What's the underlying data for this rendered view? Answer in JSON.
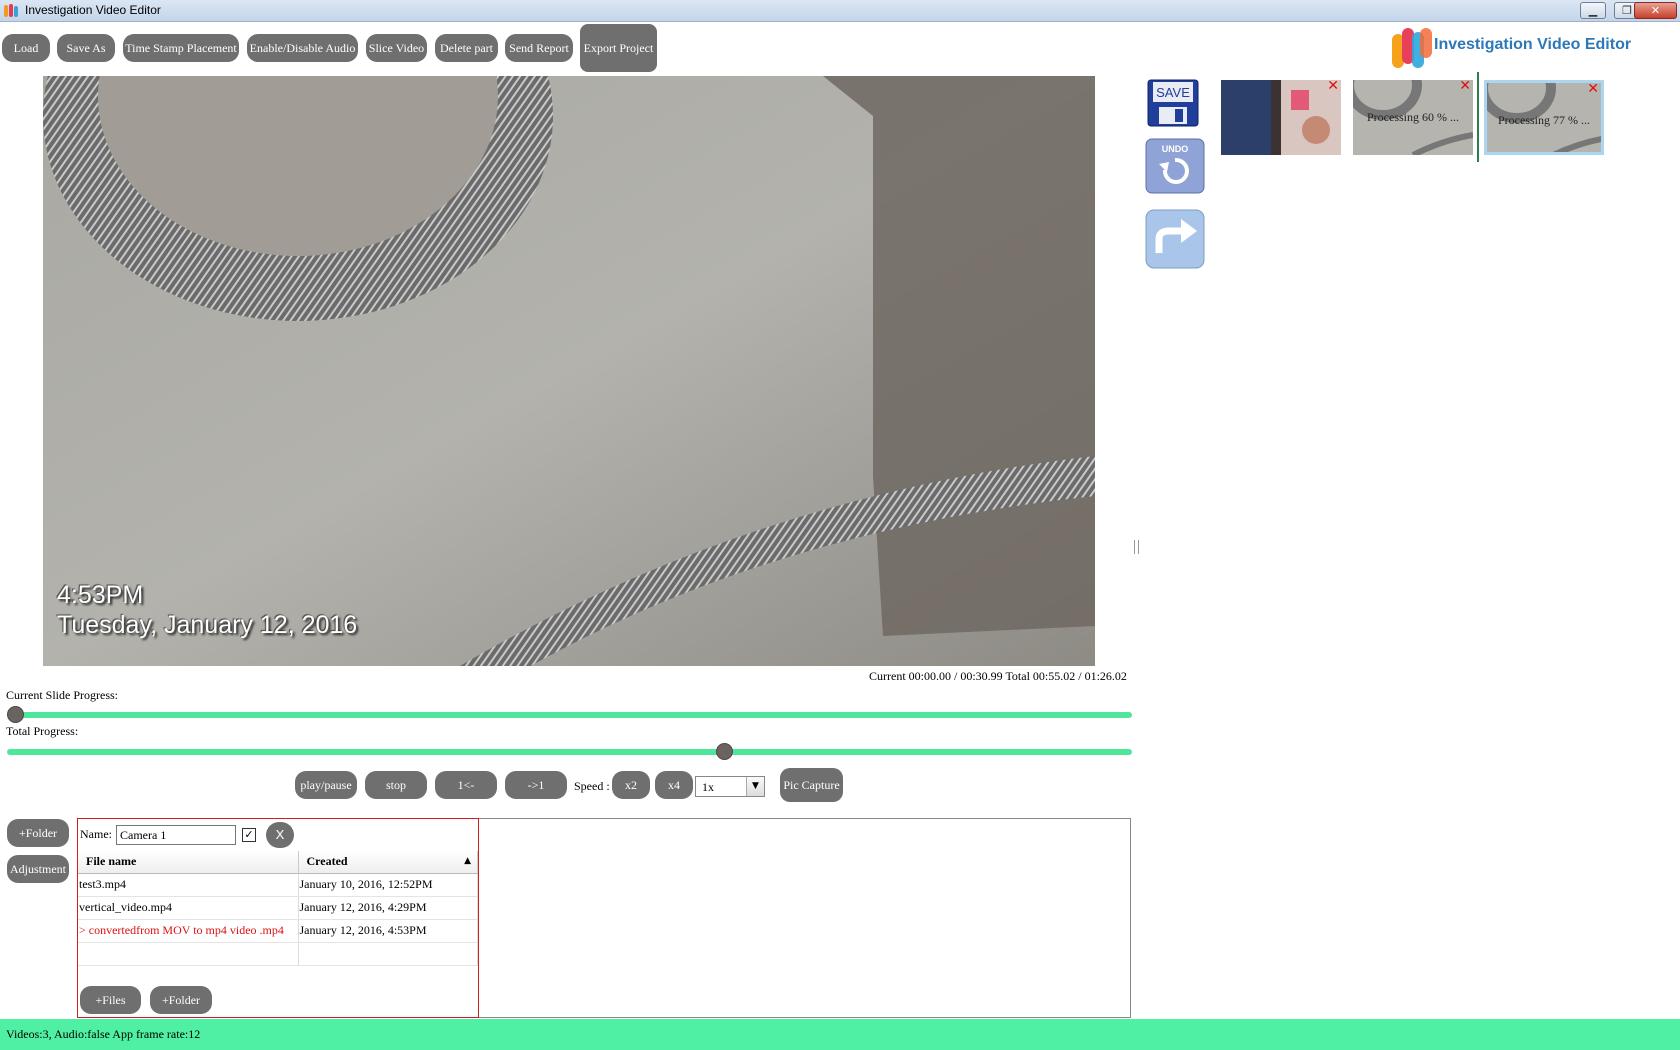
{
  "window": {
    "title": "Investigation Video Editor",
    "controls": [
      "minimize",
      "restore",
      "close"
    ]
  },
  "toolbar": {
    "load": "Load",
    "save_as": "Save As",
    "time_stamp": "Time Stamp Placement",
    "audio": "Enable/Disable Audio",
    "slice": "Slice Video",
    "delete_part": "Delete part",
    "send_report": "Send Report",
    "export_project": "Export Project"
  },
  "logo": {
    "text": "Investigation Video Editor"
  },
  "video": {
    "overlay_time": "4:53PM",
    "overlay_date": "Tuesday, January 12, 2016",
    "time_readout": "Current 00:00.00 / 00:30.99   Total 00:55.02 / 01:26.02"
  },
  "progress": {
    "current_label": "Current Slide Progress:",
    "current_fraction": 0.0,
    "total_label": "Total Progress:",
    "total_fraction": 0.64
  },
  "playback": {
    "play_pause": "play/pause",
    "stop": "stop",
    "prev": "1<-",
    "next": "->1",
    "speed_label": "Speed :",
    "x2": "x2",
    "x4": "x4",
    "speed_value": "1x",
    "pic_capture": "Pic Capture"
  },
  "side": {
    "save_icon_text": "SAVE",
    "undo_icon_text": "UNDO"
  },
  "thumbnails": [
    {
      "caption": ""
    },
    {
      "caption": "Processing 60 % ..."
    },
    {
      "caption": "Processing 77 % ..."
    }
  ],
  "folder_panel": {
    "add_folder": "+Folder",
    "adjustment": "Adjustment",
    "name_label": "Name:",
    "name_value": "Camera 1",
    "close": "X",
    "columns": [
      "File name",
      "Created"
    ],
    "rows": [
      {
        "name": "test3.mp4",
        "created": "January 10, 2016, 12:52PM"
      },
      {
        "name": "vertical_video.mp4",
        "created": "January 12, 2016, 4:29PM"
      },
      {
        "name": ">  convertedfrom MOV to mp4 video .mp4",
        "created": "January 12, 2016, 4:53PM"
      }
    ],
    "add_files": "+Files",
    "add_folder_inner": "+Folder"
  },
  "status": {
    "text": "Videos:3, Audio:false App frame rate:12"
  },
  "colors": {
    "accent_green": "#4ff0a3",
    "button_gray": "#6f6f6f",
    "selected_red": "#d11111"
  }
}
